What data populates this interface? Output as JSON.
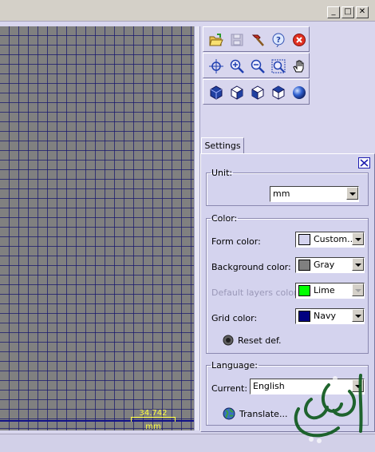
{
  "window": {
    "minimize_glyph": "_",
    "maximize_glyph": "□",
    "close_glyph": "✕"
  },
  "toolbar": {
    "rows": [
      [
        "open-folder-icon",
        "save-icon",
        "hammer-icon",
        "help-icon",
        "stop-icon"
      ],
      [
        "pan-cross-icon",
        "zoom-in-icon",
        "zoom-out-icon",
        "zoom-fit-icon",
        "hand-icon"
      ],
      [
        "cube-view-1-icon",
        "cube-view-2-icon",
        "cube-view-3-icon",
        "cube-view-4-icon",
        "sphere-icon"
      ]
    ]
  },
  "canvas": {
    "grid_color": "#000080",
    "background": "#808080",
    "scale": {
      "value": "34.742",
      "unit": "mm"
    }
  },
  "tabs": {
    "settings": "Settings"
  },
  "unit_group": {
    "legend": "Unit:",
    "selected": "mm"
  },
  "color_group": {
    "legend": "Color:",
    "form_color": {
      "label": "Form color:",
      "value": "Custom...",
      "swatch": "#d4d3ee"
    },
    "background_color": {
      "label": "Background color:",
      "value": "Gray",
      "swatch": "#808080"
    },
    "default_layers_color": {
      "label": "Default layers color:",
      "value": "Lime",
      "swatch": "#00ff00",
      "disabled": true
    },
    "grid_color": {
      "label": "Grid color:",
      "value": "Navy",
      "swatch": "#000080"
    },
    "reset_label": "Reset def."
  },
  "language_group": {
    "legend": "Language:",
    "current_label": "Current:",
    "current_value": "English",
    "translate_label": "Translate..."
  }
}
